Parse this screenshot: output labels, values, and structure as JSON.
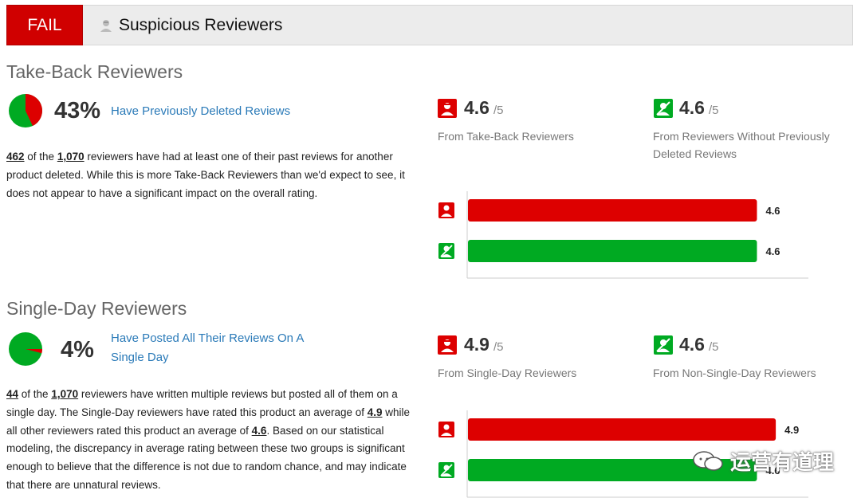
{
  "header": {
    "status": "FAIL",
    "title": "Suspicious Reviewers"
  },
  "colors": {
    "red": "#dd0000",
    "green": "#00aa22",
    "link": "#2a7ab8"
  },
  "takeback": {
    "title": "Take-Back Reviewers",
    "percent": "43%",
    "percent_value": 43,
    "link": "Have Previously Deleted Reviews",
    "count": "462",
    "total": "1,070",
    "text_a": " of the ",
    "text_b": " reviewers have had at least one of their past reviews for another product deleted. While this is more Take-Back Reviewers than we'd expect to see, it does not appear to have a significant impact on the overall rating.",
    "left_rating": "4.6",
    "left_suffix": "/5",
    "left_label": "From Take-Back Reviewers",
    "right_rating": "4.6",
    "right_suffix": "/5",
    "right_label": "From Reviewers Without Previously Deleted Reviews"
  },
  "singleday": {
    "title": "Single-Day Reviewers",
    "percent": "4%",
    "percent_value": 4,
    "link": "Have Posted All Their Reviews On A Single Day",
    "count": "44",
    "total": "1,070",
    "text_a": " of the ",
    "text_b": " reviewers have written multiple reviews but posted all of them on a single day. The Single-Day reviewers have rated this product an average of ",
    "avg_single": "4.9",
    "text_c": " while all other reviewers rated this product an average of ",
    "avg_other": "4.6",
    "text_d": ". Based on our statistical modeling, the discrepancy in average rating between these two groups is significant enough to believe that the difference is not due to random chance, and may indicate that there are unnatural reviews.",
    "left_rating": "4.9",
    "left_suffix": "/5",
    "left_label": "From Single-Day Reviewers",
    "right_rating": "4.6",
    "right_suffix": "/5",
    "right_label": "From Non-Single-Day Reviewers"
  },
  "chart_data": [
    {
      "type": "bar",
      "categories": [
        "Take-Back Reviewers",
        "Reviewers Without Previously Deleted Reviews"
      ],
      "values": [
        4.6,
        4.6
      ],
      "labels": [
        "4.6",
        "4.6"
      ],
      "colors": [
        "#dd0000",
        "#00aa22"
      ],
      "xlim": [
        0,
        5
      ]
    },
    {
      "type": "bar",
      "categories": [
        "Single-Day Reviewers",
        "Non-Single-Day Reviewers"
      ],
      "values": [
        4.9,
        4.6
      ],
      "labels": [
        "4.9",
        "4.6"
      ],
      "colors": [
        "#dd0000",
        "#00aa22"
      ],
      "xlim": [
        0,
        5
      ]
    }
  ],
  "watermark": {
    "text": "运营有道理"
  }
}
